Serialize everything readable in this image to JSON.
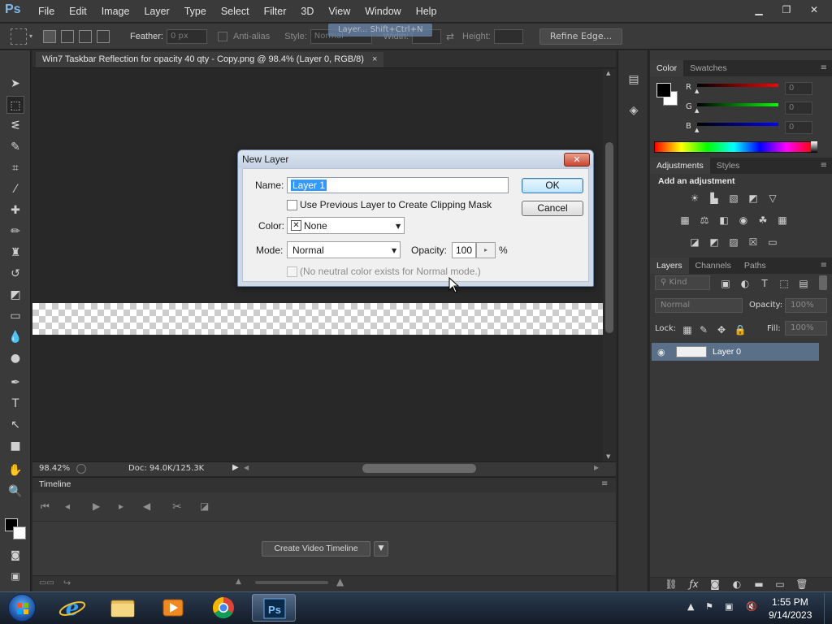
{
  "app": {
    "logo": "Ps",
    "menu": [
      "File",
      "Edit",
      "Image",
      "Layer",
      "Type",
      "Select",
      "Filter",
      "3D",
      "View",
      "Window",
      "Help"
    ]
  },
  "options": {
    "feather_label": "Feather:",
    "feather_value": "0 px",
    "antialias_label": "Anti-alias",
    "style_label": "Style:",
    "style_value": "Normal",
    "width_label": "Width:",
    "height_label": "Height:",
    "refine_edge": "Refine Edge...",
    "tooltip": "Layer...   Shift+Ctrl+N"
  },
  "document": {
    "tab_title": "Win7 Taskbar Reflection for opacity 40 qty - Copy.png @ 98.4% (Layer 0, RGB/8)",
    "tab_close": "×",
    "zoom": "98.42%",
    "doc_size": "Doc: 94.0K/125.3K"
  },
  "timeline": {
    "title": "Timeline",
    "create_button": "Create Video Timeline"
  },
  "color_panel": {
    "tabs": [
      "Color",
      "Swatches"
    ],
    "r_label": "R",
    "g_label": "G",
    "b_label": "B",
    "r_value": "0",
    "g_value": "0",
    "b_value": "0"
  },
  "adjustments_panel": {
    "tabs": [
      "Adjustments",
      "Styles"
    ],
    "heading": "Add an adjustment"
  },
  "layers_panel": {
    "tabs": [
      "Layers",
      "Channels",
      "Paths"
    ],
    "kind_label": "Kind",
    "blend_mode": "Normal",
    "opacity_label": "Opacity:",
    "opacity_value": "100%",
    "lock_label": "Lock:",
    "fill_label": "Fill:",
    "fill_value": "100%",
    "layer_name": "Layer 0"
  },
  "dialog": {
    "title": "New Layer",
    "close": "✕",
    "name_label": "Name:",
    "name_value": "Layer 1",
    "clipping_label": "Use Previous Layer to Create Clipping Mask",
    "color_label": "Color:",
    "color_value": "None",
    "mode_label": "Mode:",
    "mode_value": "Normal",
    "opacity_label": "Opacity:",
    "opacity_value": "100",
    "opacity_unit": "%",
    "neutral_label": "(No neutral color exists for Normal mode.)",
    "ok_label": "OK",
    "cancel_label": "Cancel"
  },
  "taskbar": {
    "time": "1:55 PM",
    "date": "9/14/2023"
  }
}
